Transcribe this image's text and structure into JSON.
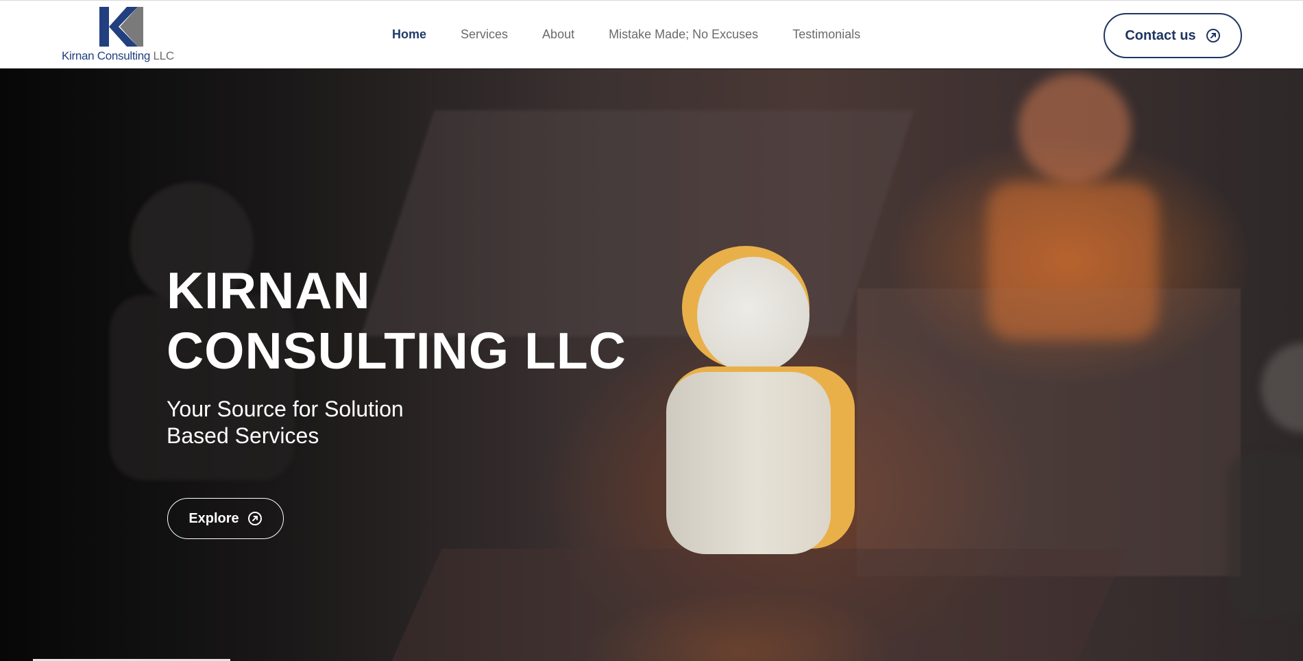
{
  "brand": {
    "name": "Kirnan Consulting",
    "suffix": "LLC",
    "colors": {
      "navy": "#22407f",
      "grey": "#6b6b6b"
    }
  },
  "nav": {
    "items": [
      {
        "label": "Home",
        "active": true
      },
      {
        "label": "Services",
        "active": false
      },
      {
        "label": "About",
        "active": false
      },
      {
        "label": "Mistake Made; No Excuses",
        "active": false
      },
      {
        "label": "Testimonials",
        "active": false
      }
    ],
    "contact_label": "Contact us",
    "contact_icon": "arrow-up-right-circle-icon"
  },
  "hero": {
    "title_line1": "KIRNAN",
    "title_line2": "CONSULTING LLC",
    "subtitle": "Your Source for Solution Based Services",
    "explore_label": "Explore",
    "explore_icon": "arrow-up-right-circle-icon"
  }
}
